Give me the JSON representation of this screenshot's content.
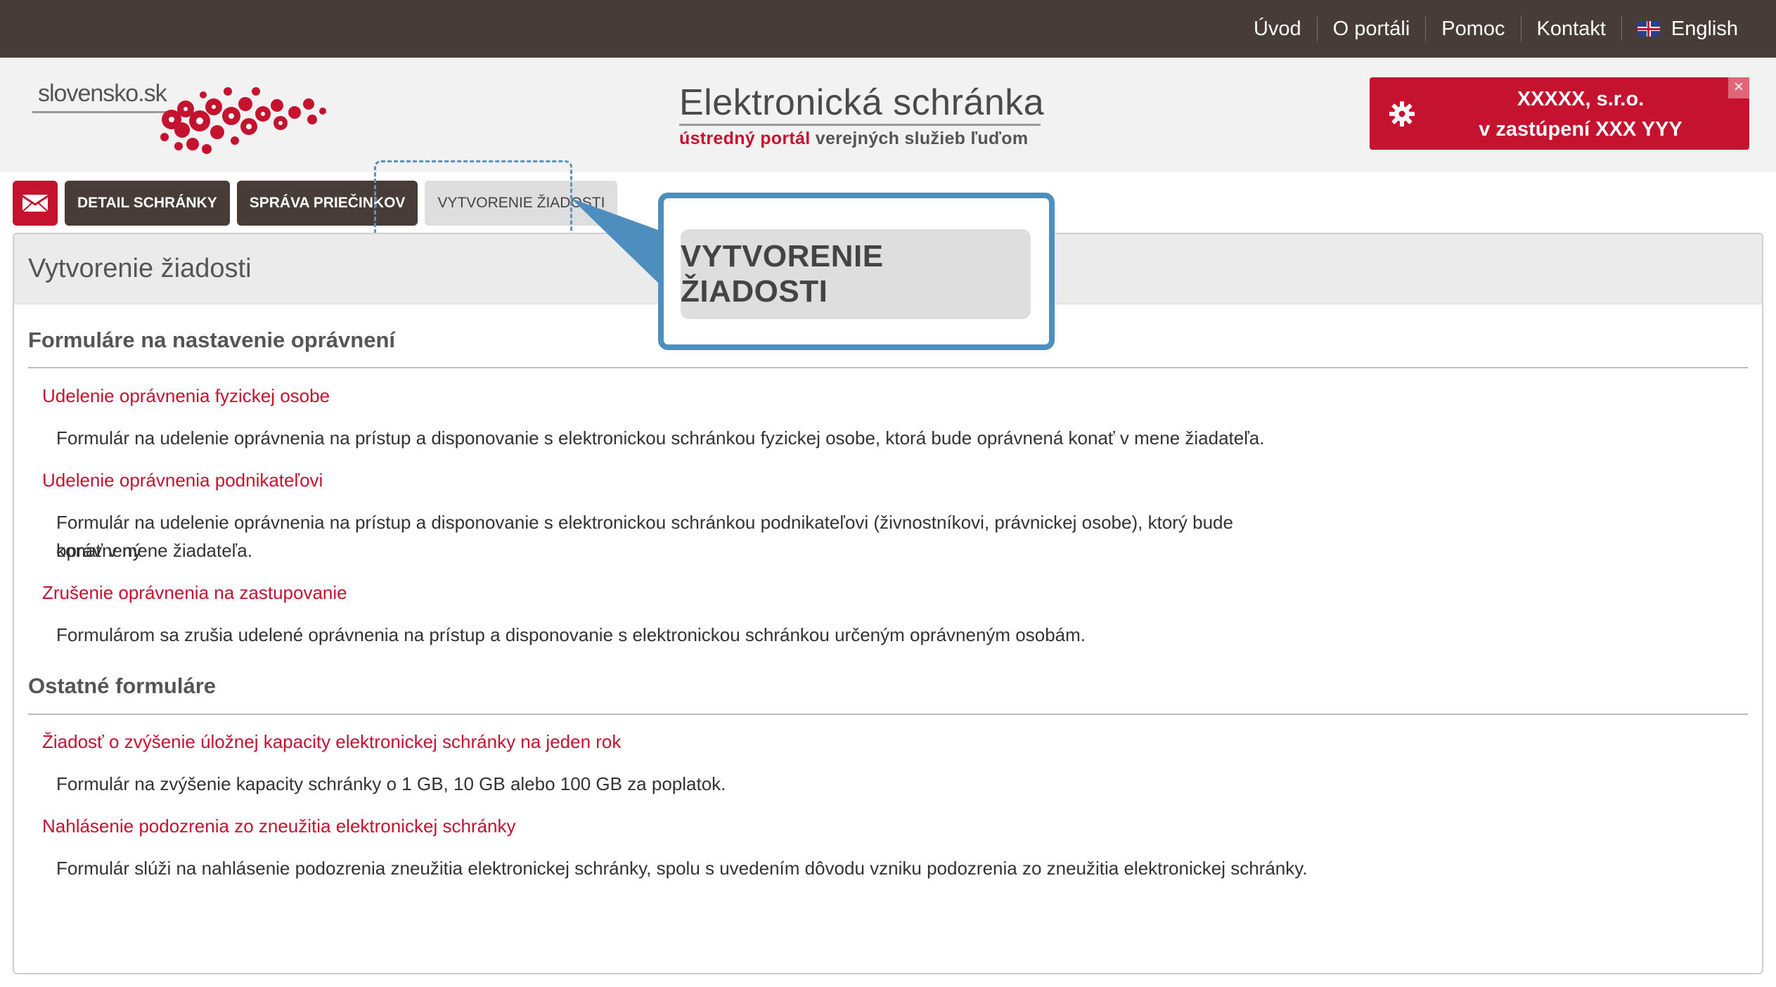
{
  "topnav": {
    "items": [
      "Úvod",
      "O portáli",
      "Pomoc",
      "Kontakt"
    ],
    "language_label": "English"
  },
  "header": {
    "logo_text": "slovensko.sk",
    "title": "Elektronická schránka",
    "subtitle_red": "ústredný portál",
    "subtitle_rest": "verejných služieb ľuďom",
    "user_line1": "XXXXX, s.r.o.",
    "user_line2": "v zastúpení XXX YYY",
    "close_symbol": "×"
  },
  "tabs": {
    "detail": "DETAIL SCHRÁNKY",
    "folders": "SPRÁVA PRIEČINKOV",
    "create": "VYTVORENIE ŽIADOSTI"
  },
  "callout": {
    "label": "VYTVORENIE ŽIADOSTI"
  },
  "main": {
    "heading": "Vytvorenie žiadosti",
    "section1": {
      "title": "Formuláre na nastavenie oprávnení",
      "items": [
        {
          "link": "Udelenie oprávnenia fyzickej osobe",
          "desc": "Formulár na udelenie oprávnenia na prístup a disponovanie s elektronickou schránkou fyzickej osobe, ktorá bude oprávnená konať v mene žiadateľa."
        },
        {
          "link": "Udelenie oprávnenia podnikateľovi",
          "desc_line1": "Formulár na udelenie oprávnenia na prístup a disponovanie s elektronickou schránkou podnikateľovi (živnostníkovi, právnickej osobe), ktorý bude oprávnený",
          "desc_line2": "konať v mene žiadateľa."
        },
        {
          "link": "Zrušenie oprávnenia na zastupovanie",
          "desc": "Formulárom sa zrušia udelené oprávnenia na prístup a disponovanie s elektronickou schránkou určeným oprávneným osobám."
        }
      ]
    },
    "section2": {
      "title": "Ostatné formuláre",
      "items": [
        {
          "link": "Žiadosť o zvýšenie úložnej kapacity elektronickej schránky na jeden rok",
          "desc": "Formulár na zvýšenie kapacity schránky o 1 GB, 10 GB alebo 100 GB za poplatok."
        },
        {
          "link": "Nahlásenie podozrenia zo zneužitia elektronickej schránky",
          "desc": "Formulár slúži na nahlásenie podozrenia zneužitia elektronickej schránky, spolu s uvedením dôvodu vzniku podozrenia zo zneužitia elektronickej schránky."
        }
      ]
    }
  },
  "colors": {
    "topbar": "#473c36",
    "brand_red": "#c4122f",
    "callout_blue": "#4e8ebf"
  }
}
